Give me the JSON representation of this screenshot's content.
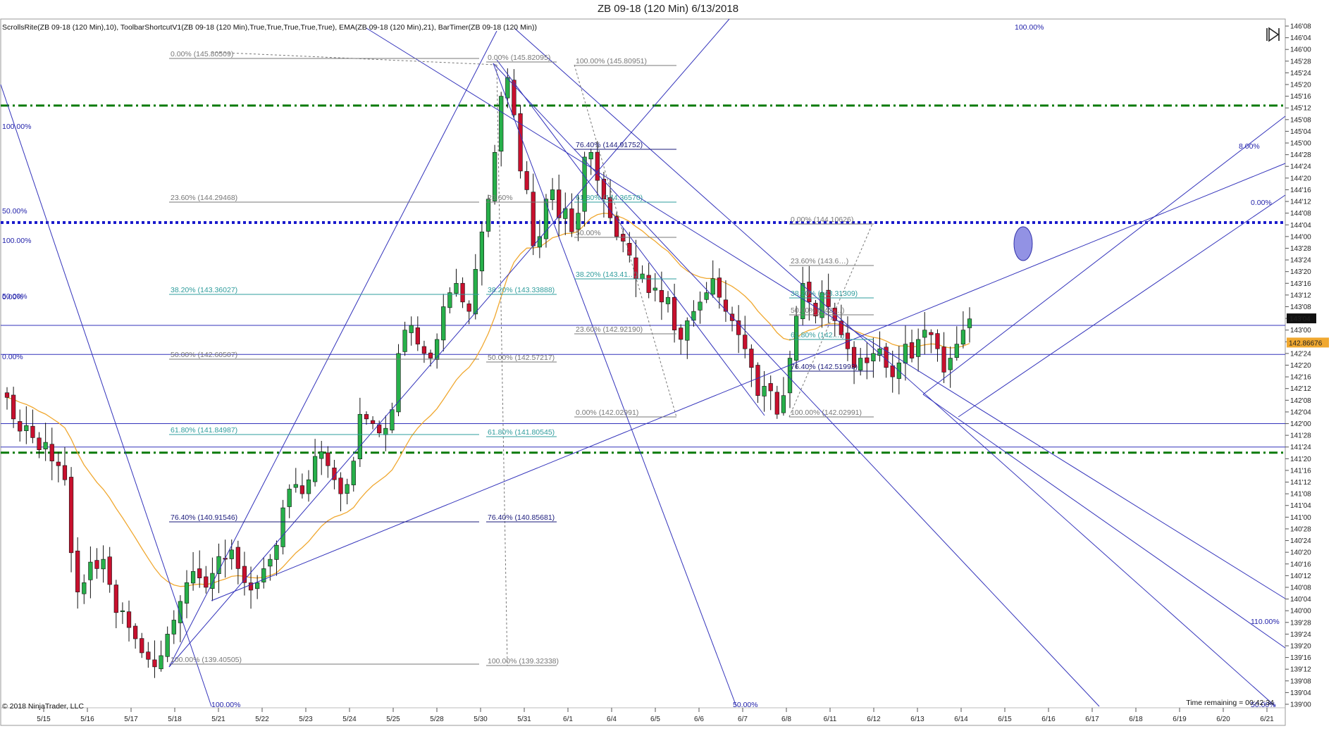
{
  "window": {
    "title": "ZB 09-18 (120 Min)  6/13/2018"
  },
  "indicators_label": "ScrollsRite(ZB 09-18 (120 Min),10), ToolbarShortcutV1(ZB 09-18 (120 Min),True,True,True,True,True), EMA(ZB 09-18 (120 Min),21), BarTimer(ZB 09-18 (120 Min))",
  "copyright": "© 2018 NinjaTrader, LLC",
  "time_remaining": "Time remaining = 00:42:34",
  "price_markers": {
    "last": "143'04",
    "ema": "142.86676"
  },
  "colors": {
    "up_candle": "#27b04a",
    "down_candle": "#c8102e",
    "ema": "#f0a830",
    "green_line": "#0b7a0b",
    "blue_dotted": "#1a1acc",
    "pitchfork": "#3333bb",
    "fib_gray": "#777777",
    "fib_teal": "#2e9c9c",
    "fib_navy": "#1a1a7a",
    "ellipse_fill": "#7777dd"
  },
  "chart_data": {
    "type": "candlestick",
    "title": "ZB 09-18 (120 Min)  6/13/2018",
    "x_tick_labels": [
      "5/15",
      "5/16",
      "5/17",
      "5/18",
      "5/21",
      "5/22",
      "5/23",
      "5/24",
      "5/25",
      "5/28",
      "5/30",
      "5/31",
      "6/1",
      "6/4",
      "6/5",
      "6/6",
      "6/7",
      "6/8",
      "6/11",
      "6/12",
      "6/13",
      "6/14",
      "6/15",
      "6/16",
      "6/17",
      "6/18",
      "6/19",
      "6/20",
      "6/21"
    ],
    "y_tick_labels": [
      "146'08",
      "146'04",
      "146'00",
      "145'28",
      "145'24",
      "145'20",
      "145'16",
      "145'12",
      "145'08",
      "145'04",
      "145'00",
      "144'28",
      "144'24",
      "144'20",
      "144'16",
      "144'12",
      "144'08",
      "144'04",
      "144'00",
      "143'28",
      "143'24",
      "143'20",
      "143'16",
      "143'12",
      "143'08",
      "143'04",
      "143'00",
      "142'28",
      "142'24",
      "142'20",
      "142'16",
      "142'12",
      "142'08",
      "142'04",
      "142'00",
      "141'28",
      "141'24",
      "141'20",
      "141'16",
      "141'12",
      "141'08",
      "141'04",
      "141'00",
      "140'28",
      "140'24",
      "140'20",
      "140'16",
      "140'12",
      "140'08",
      "140'04",
      "140'00",
      "139'28",
      "139'24",
      "139'20",
      "139'16",
      "139'12",
      "139'08",
      "139'04",
      "139'00"
    ],
    "ylim": [
      139.0,
      146.25
    ],
    "last_price": 143.125,
    "ema_last": 142.86676,
    "price_path": [
      142.28,
      142.05,
      141.92,
      141.98,
      141.85,
      141.72,
      141.8,
      141.6,
      141.55,
      141.4,
      140.62,
      140.2,
      140.3,
      140.52,
      140.45,
      140.55,
      140.28,
      139.98,
      140.0,
      139.82,
      139.7,
      139.55,
      139.48,
      139.4,
      139.52,
      139.75,
      139.9,
      140.1,
      140.3,
      140.42,
      140.35,
      140.25,
      140.4,
      140.58,
      140.55,
      140.65,
      140.45,
      140.3,
      140.22,
      140.3,
      140.45,
      140.55,
      140.7,
      141.1,
      141.3,
      141.35,
      141.25,
      141.4,
      141.65,
      141.7,
      141.55,
      141.4,
      141.25,
      141.35,
      141.6,
      142.1,
      142.05,
      142.0,
      141.9,
      141.95,
      142.15,
      142.75,
      143.0,
      143.05,
      142.85,
      142.75,
      142.7,
      142.9,
      143.25,
      143.4,
      143.5,
      143.3,
      143.2,
      143.65,
      144.05,
      144.4,
      144.9,
      145.5,
      145.7,
      145.3,
      144.7,
      144.5,
      143.9,
      144.0,
      144.4,
      144.5,
      144.2,
      144.3,
      144.05,
      144.25,
      144.85,
      144.9,
      144.6,
      144.4,
      144.2,
      144.0,
      143.95,
      143.8,
      143.55,
      143.6,
      143.4,
      143.45,
      143.3,
      143.35,
      143.0,
      142.9,
      143.1,
      143.2,
      143.3,
      143.4,
      143.55,
      143.35,
      143.2,
      143.1,
      142.95,
      142.8,
      142.6,
      142.3,
      142.4,
      142.35,
      142.1,
      142.3,
      142.7,
      143.15,
      143.5,
      143.3,
      143.15,
      143.4,
      143.25,
      143.1,
      142.95,
      142.8,
      142.6,
      142.7,
      142.65,
      142.75,
      142.8,
      142.6,
      142.5,
      142.65,
      142.85,
      142.7,
      142.9,
      143.0,
      142.95,
      142.8,
      142.55,
      142.7,
      142.85,
      143.0,
      143.12
    ],
    "ema_period": 21,
    "horizontal_levels": [
      {
        "name": "green-upper",
        "price": 145.4,
        "style": "dash-dot"
      },
      {
        "name": "blue-dotted",
        "price": 144.15,
        "style": "dotted"
      },
      {
        "name": "blue-1",
        "price": 143.05,
        "style": "solid"
      },
      {
        "name": "blue-2",
        "price": 142.74,
        "style": "solid"
      },
      {
        "name": "blue-3",
        "price": 142.0,
        "style": "solid"
      },
      {
        "name": "blue-4",
        "price": 141.75,
        "style": "solid"
      },
      {
        "name": "green-lower",
        "price": 141.69,
        "style": "dash-dot"
      }
    ],
    "fib_labels": [
      {
        "text": "0.00% (145.80509)",
        "color": "gray"
      },
      {
        "text": "23.60% (144.29468)",
        "color": "gray"
      },
      {
        "text": "38.20% (143.36027)",
        "color": "teal"
      },
      {
        "text": "50.00% (142.60507)",
        "color": "gray"
      },
      {
        "text": "61.80% (141.84987)",
        "color": "teal"
      },
      {
        "text": "76.40% (140.91546)",
        "color": "navy"
      },
      {
        "text": "100.00% (139.40505)",
        "color": "gray"
      },
      {
        "text": "0.00% (145.82095)",
        "color": "gray"
      },
      {
        "text": "23.60%",
        "color": "gray"
      },
      {
        "text": "38.20% (143.33888)",
        "color": "teal"
      },
      {
        "text": "50.00% (142.57217)",
        "color": "gray"
      },
      {
        "text": "61.80% (141.80545)",
        "color": "teal"
      },
      {
        "text": "76.40% (140.85681)",
        "color": "navy"
      },
      {
        "text": "100.00% (139.32338)",
        "color": "gray"
      },
      {
        "text": "100.00% (145.80951)",
        "color": "gray"
      },
      {
        "text": "76.40% (144.91752)",
        "color": "navy"
      },
      {
        "text": "61.80% (144.36570)",
        "color": "teal"
      },
      {
        "text": "50.00%",
        "color": "gray"
      },
      {
        "text": "38.20% (143.41…)",
        "color": "teal"
      },
      {
        "text": "23.60% (142.92190)",
        "color": "gray"
      },
      {
        "text": "0.00% (142.02991)",
        "color": "gray"
      },
      {
        "text": "0.00% (144.10626)",
        "color": "gray"
      },
      {
        "text": "23.60% (143.6…)",
        "color": "gray"
      },
      {
        "text": "38.20% (143.31309)",
        "color": "teal"
      },
      {
        "text": "50.00% (142.…)",
        "color": "gray"
      },
      {
        "text": "61.80% (142.…)",
        "color": "teal"
      },
      {
        "text": "76.40% (142.51993)",
        "color": "navy"
      },
      {
        "text": "100.00% (142.02991)",
        "color": "gray"
      }
    ],
    "pitchfork_labels": [
      "100.00%",
      "50.00%",
      "100.00%",
      "0.00%",
      "0.00%",
      "50.00%",
      "8.00%",
      "0.00%",
      "110.00%",
      "100.00%",
      "50.00%",
      "100.00%",
      "50.00%"
    ]
  }
}
